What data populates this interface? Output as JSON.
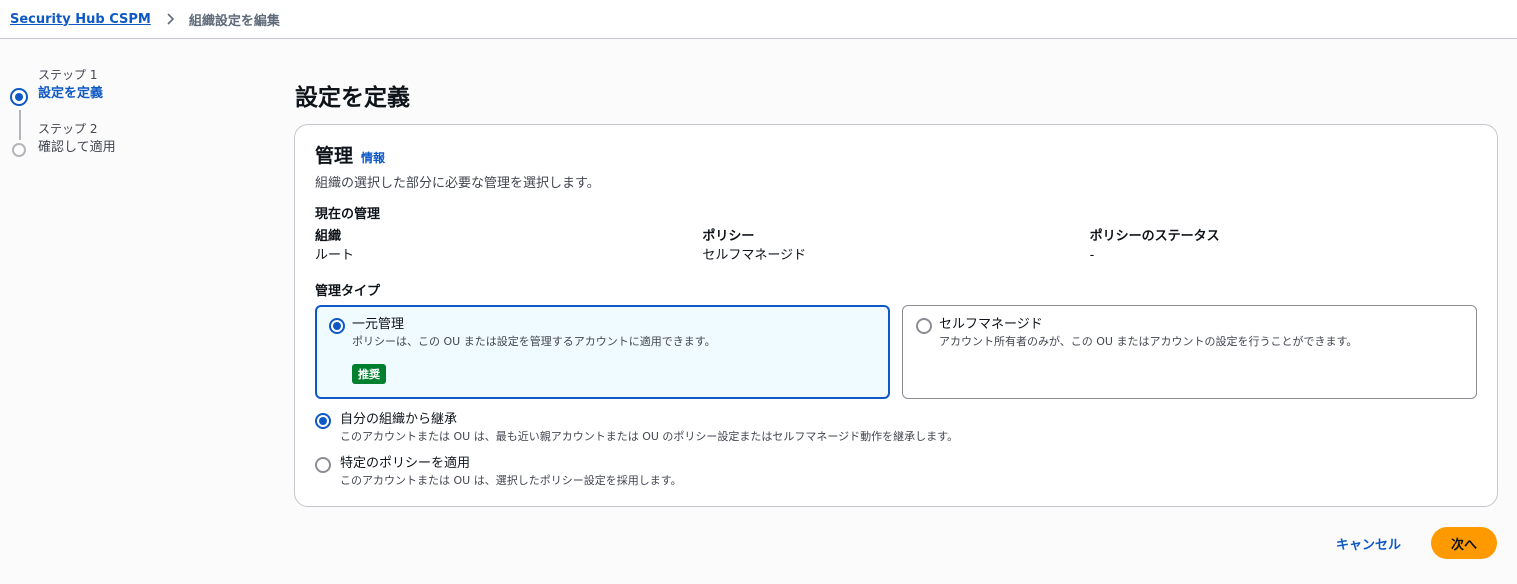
{
  "breadcrumb": {
    "root": "Security Hub CSPM",
    "current": "組織設定を編集"
  },
  "stepper": {
    "steps": [
      {
        "sub": "ステップ 1",
        "title": "設定を定義",
        "state": "active"
      },
      {
        "sub": "ステップ 2",
        "title": "確認して適用",
        "state": "inactive"
      }
    ]
  },
  "page": {
    "title": "設定を定義"
  },
  "card": {
    "title": "管理",
    "info": "情報",
    "description": "組織の選択した部分に必要な管理を選択します。",
    "current_section": "現在の管理",
    "current": [
      {
        "key": "組織",
        "value": "ルート"
      },
      {
        "key": "ポリシー",
        "value": "セルフマネージド"
      },
      {
        "key": "ポリシーのステータス",
        "value": "-"
      }
    ],
    "type_section": "管理タイプ",
    "tiles": [
      {
        "label": "一元管理",
        "desc": "ポリシーは、この OU または設定を管理するアカウントに適用できます。",
        "badge": "推奨",
        "selected": true
      },
      {
        "label": "セルフマネージド",
        "desc": "アカウント所有者のみが、この OU またはアカウントの設定を行うことができます。",
        "selected": false
      }
    ],
    "options": [
      {
        "label": "自分の組織から継承",
        "desc": "このアカウントまたは OU は、最も近い親アカウントまたは OU のポリシー設定またはセルフマネージド動作を継承します。",
        "checked": true
      },
      {
        "label": "特定のポリシーを適用",
        "desc": "このアカウントまたは OU は、選択したポリシー設定を採用します。",
        "checked": false
      }
    ]
  },
  "actions": {
    "cancel": "キャンセル",
    "next": "次へ"
  },
  "colors": {
    "primary": "#0e59c5",
    "accent": "#ff9900",
    "success": "#00802f"
  }
}
